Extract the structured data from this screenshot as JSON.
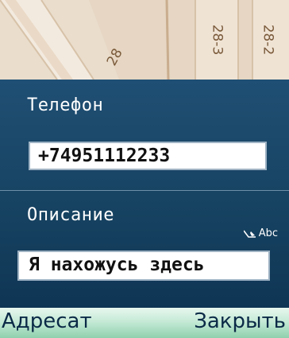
{
  "map": {
    "street_numbers": [
      "28",
      "28-3",
      "28-2"
    ]
  },
  "form": {
    "phone": {
      "label": "Телефон",
      "value": "+74951112233"
    },
    "description": {
      "label": "Описание",
      "value": "Я нахожусь здесь"
    }
  },
  "input_mode": {
    "icon": "pen-icon",
    "label": "Abc"
  },
  "softkeys": {
    "left": "Адресат",
    "right": "Закрыть"
  },
  "colors": {
    "panel": "#174362",
    "softbar": "#c5ead6",
    "text_light": "#ffffff"
  }
}
